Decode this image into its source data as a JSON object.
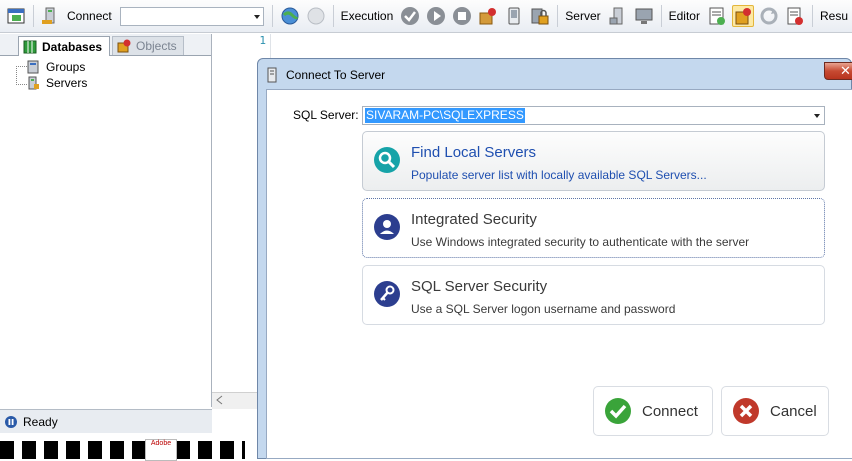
{
  "toolbar": {
    "connect_label": "Connect",
    "connect_combo_value": "",
    "execution_label": "Execution",
    "server_label": "Server",
    "editor_label": "Editor",
    "results_label": "Resu"
  },
  "left_panel": {
    "tabs": [
      {
        "label": "Databases"
      },
      {
        "label": "Objects"
      }
    ],
    "tree": [
      {
        "label": "Groups"
      },
      {
        "label": "Servers"
      }
    ],
    "status": "Ready"
  },
  "editor": {
    "line_number": "1"
  },
  "dialog": {
    "title": "Connect To Server",
    "close_glyph": "✕",
    "sql_server_label": "SQL Server:",
    "sql_server_value": "SIVARAM-PC\\SQLEXPRESS",
    "options": [
      {
        "title": "Find Local Servers",
        "desc": "Populate server list with locally available SQL Servers..."
      },
      {
        "title": "Integrated Security",
        "desc": "Use Windows integrated security to authenticate with the server"
      },
      {
        "title": "SQL Server Security",
        "desc": "Use a SQL Server logon username and password"
      }
    ],
    "connect_button": "Connect",
    "cancel_button": "Cancel"
  },
  "taskbar": {
    "adobe_text": "Adobe"
  },
  "colors": {
    "accent_blue": "#1f4fb0",
    "connect_green": "#3aa43a",
    "cancel_red": "#c0392b",
    "dialog_frame": "#c4d8ee"
  }
}
